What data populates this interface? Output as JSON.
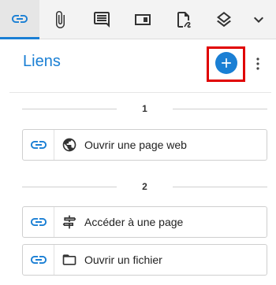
{
  "toolbar": {
    "tools": [
      {
        "icon": "link-icon",
        "active": true
      },
      {
        "icon": "paperclip-icon"
      },
      {
        "icon": "comment-icon"
      },
      {
        "icon": "form-field-icon"
      },
      {
        "icon": "document-signature-icon"
      },
      {
        "icon": "layers-icon"
      },
      {
        "icon": "chevron-down-icon"
      }
    ],
    "accent": "#1a7fd4"
  },
  "panel": {
    "title": "Liens",
    "add_icon": "plus-icon",
    "more_icon": "more-vertical-icon",
    "groups": [
      {
        "number": "1",
        "items": [
          {
            "icon": "globe-icon",
            "label": "Ouvrir une page web"
          }
        ]
      },
      {
        "number": "2",
        "items": [
          {
            "icon": "signpost-icon",
            "label": "Accéder à une page"
          },
          {
            "icon": "folder-open-icon",
            "label": "Ouvrir un fichier"
          }
        ]
      }
    ]
  },
  "colors": {
    "highlight": "#e00000",
    "accent": "#1a7fd4"
  }
}
